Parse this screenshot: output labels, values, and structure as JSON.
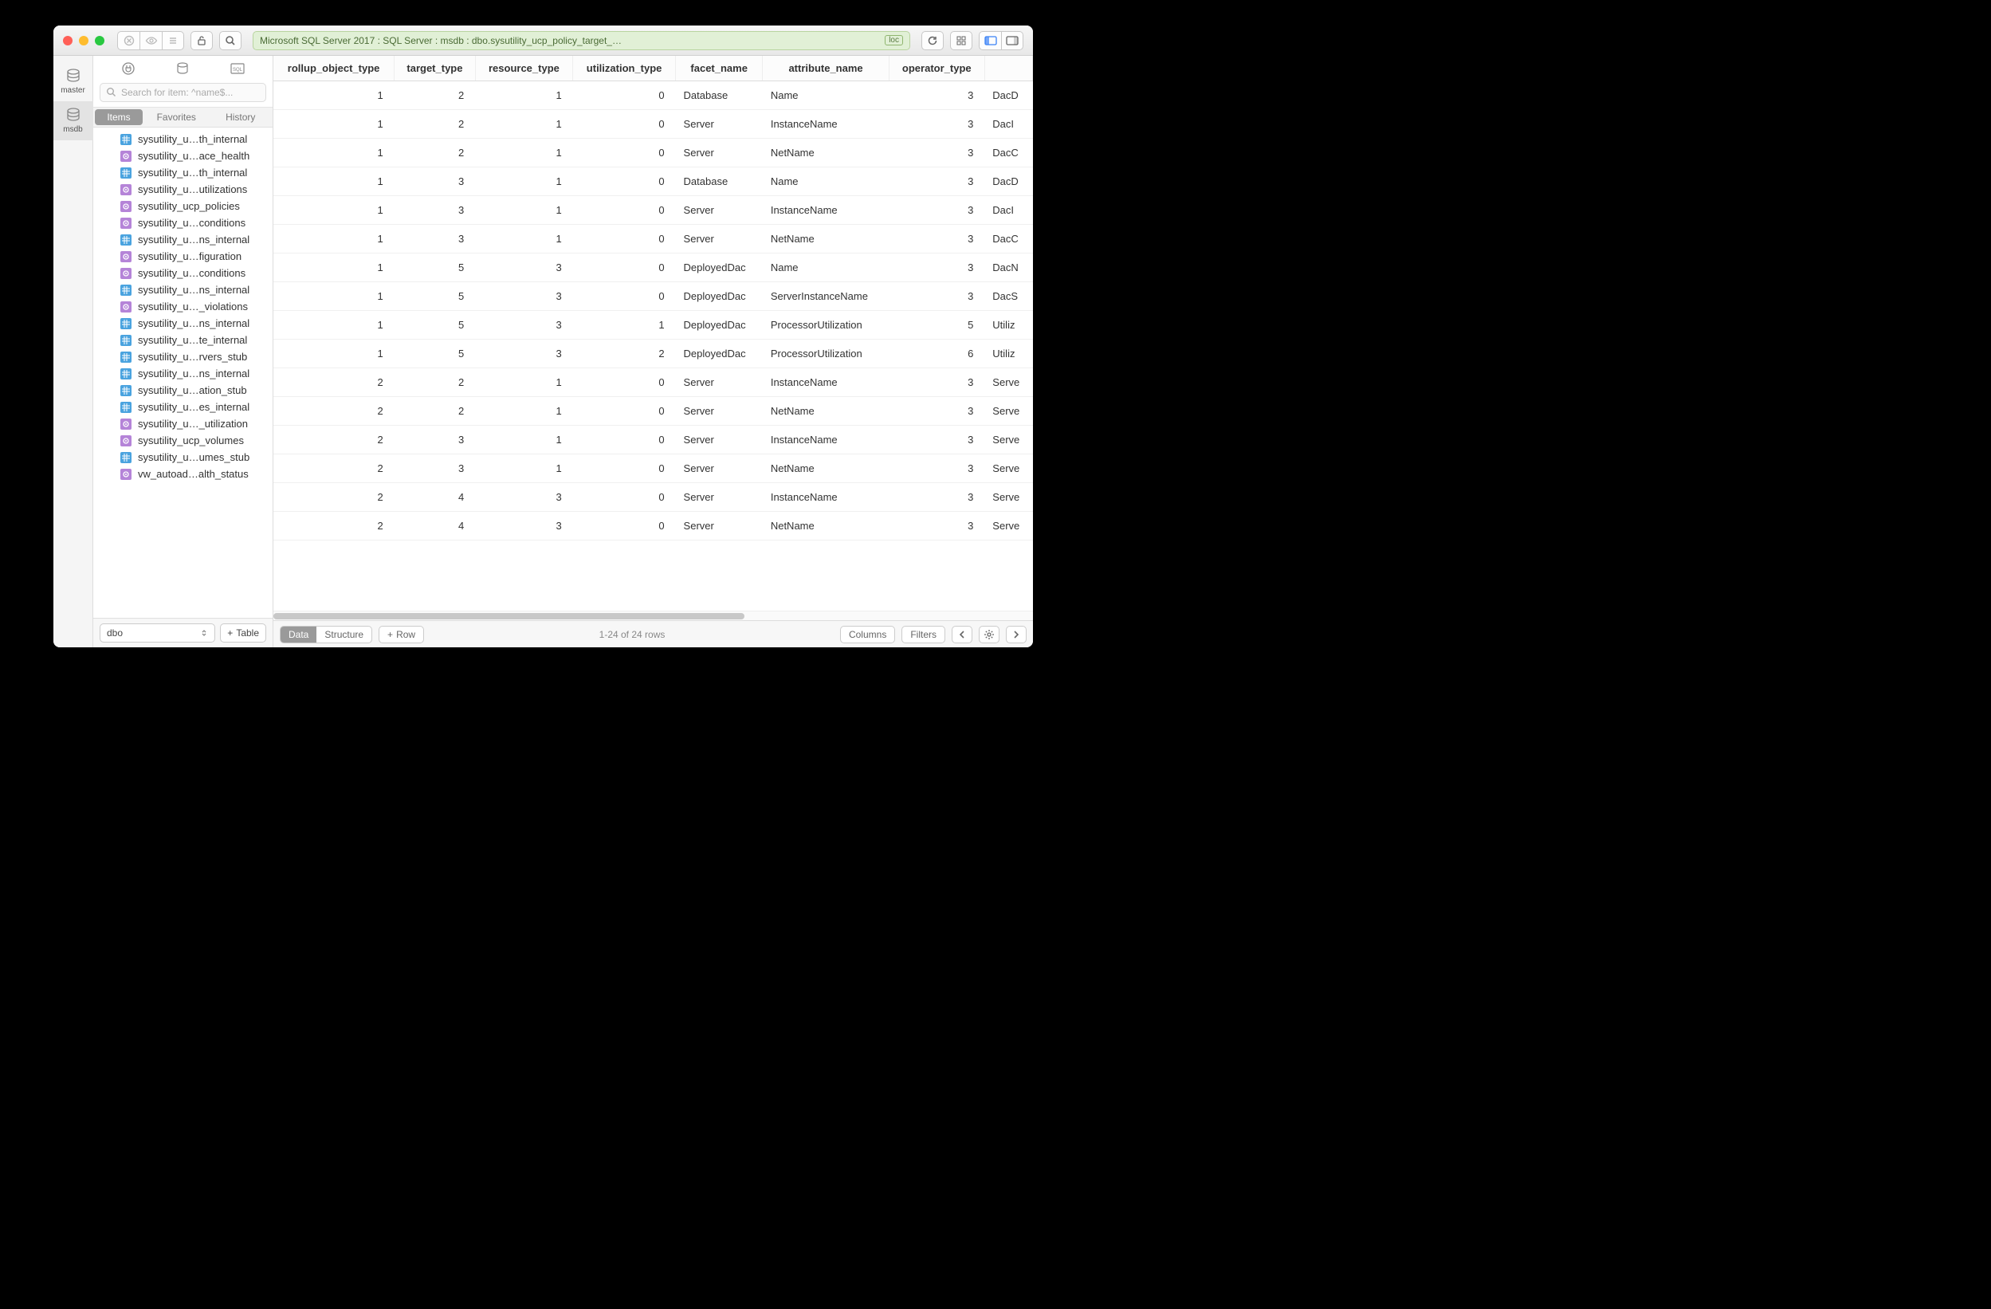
{
  "titlebar": {
    "breadcrumb": "Microsoft SQL Server 2017 : SQL Server : msdb : dbo.sysutility_ucp_policy_target_…",
    "loc_badge": "loc"
  },
  "dbbar": {
    "items": [
      {
        "name": "master",
        "selected": false
      },
      {
        "name": "msdb",
        "selected": true
      }
    ]
  },
  "sidebar": {
    "search_placeholder": "Search for item: ^name$...",
    "tabs": {
      "items": "Items",
      "favorites": "Favorites",
      "history": "History"
    },
    "tree": [
      {
        "type": "table",
        "label": "sysutility_u…th_internal"
      },
      {
        "type": "view",
        "label": "sysutility_u…ace_health"
      },
      {
        "type": "table",
        "label": "sysutility_u…th_internal"
      },
      {
        "type": "view",
        "label": "sysutility_u…utilizations"
      },
      {
        "type": "view",
        "label": "sysutility_ucp_policies"
      },
      {
        "type": "view",
        "label": "sysutility_u…conditions"
      },
      {
        "type": "table",
        "label": "sysutility_u…ns_internal"
      },
      {
        "type": "view",
        "label": "sysutility_u…figuration"
      },
      {
        "type": "view",
        "label": "sysutility_u…conditions"
      },
      {
        "type": "table",
        "label": "sysutility_u…ns_internal"
      },
      {
        "type": "view",
        "label": "sysutility_u…_violations"
      },
      {
        "type": "table",
        "label": "sysutility_u…ns_internal"
      },
      {
        "type": "table",
        "label": "sysutility_u…te_internal"
      },
      {
        "type": "table",
        "label": "sysutility_u…rvers_stub"
      },
      {
        "type": "table",
        "label": "sysutility_u…ns_internal"
      },
      {
        "type": "table",
        "label": "sysutility_u…ation_stub"
      },
      {
        "type": "table",
        "label": "sysutility_u…es_internal"
      },
      {
        "type": "view",
        "label": "sysutility_u…_utilization"
      },
      {
        "type": "view",
        "label": "sysutility_ucp_volumes"
      },
      {
        "type": "table",
        "label": "sysutility_u…umes_stub"
      },
      {
        "type": "view",
        "label": "vw_autoad…alth_status"
      }
    ],
    "schema": "dbo",
    "add_table": "Table"
  },
  "grid": {
    "columns": [
      "rollup_object_type",
      "target_type",
      "resource_type",
      "utilization_type",
      "facet_name",
      "attribute_name",
      "operator_type",
      ""
    ],
    "rows": [
      {
        "rollup_object_type": 1,
        "target_type": 2,
        "resource_type": 1,
        "utilization_type": 0,
        "facet_name": "Database",
        "attribute_name": "Name",
        "operator_type": 3,
        "tail": "DacD"
      },
      {
        "rollup_object_type": 1,
        "target_type": 2,
        "resource_type": 1,
        "utilization_type": 0,
        "facet_name": "Server",
        "attribute_name": "InstanceName",
        "operator_type": 3,
        "tail": "DacI"
      },
      {
        "rollup_object_type": 1,
        "target_type": 2,
        "resource_type": 1,
        "utilization_type": 0,
        "facet_name": "Server",
        "attribute_name": "NetName",
        "operator_type": 3,
        "tail": "DacC"
      },
      {
        "rollup_object_type": 1,
        "target_type": 3,
        "resource_type": 1,
        "utilization_type": 0,
        "facet_name": "Database",
        "attribute_name": "Name",
        "operator_type": 3,
        "tail": "DacD"
      },
      {
        "rollup_object_type": 1,
        "target_type": 3,
        "resource_type": 1,
        "utilization_type": 0,
        "facet_name": "Server",
        "attribute_name": "InstanceName",
        "operator_type": 3,
        "tail": "DacI"
      },
      {
        "rollup_object_type": 1,
        "target_type": 3,
        "resource_type": 1,
        "utilization_type": 0,
        "facet_name": "Server",
        "attribute_name": "NetName",
        "operator_type": 3,
        "tail": "DacC"
      },
      {
        "rollup_object_type": 1,
        "target_type": 5,
        "resource_type": 3,
        "utilization_type": 0,
        "facet_name": "DeployedDac",
        "attribute_name": "Name",
        "operator_type": 3,
        "tail": "DacN"
      },
      {
        "rollup_object_type": 1,
        "target_type": 5,
        "resource_type": 3,
        "utilization_type": 0,
        "facet_name": "DeployedDac",
        "attribute_name": "ServerInstanceName",
        "operator_type": 3,
        "tail": "DacS"
      },
      {
        "rollup_object_type": 1,
        "target_type": 5,
        "resource_type": 3,
        "utilization_type": 1,
        "facet_name": "DeployedDac",
        "attribute_name": "ProcessorUtilization",
        "operator_type": 5,
        "tail": "Utiliz"
      },
      {
        "rollup_object_type": 1,
        "target_type": 5,
        "resource_type": 3,
        "utilization_type": 2,
        "facet_name": "DeployedDac",
        "attribute_name": "ProcessorUtilization",
        "operator_type": 6,
        "tail": "Utiliz"
      },
      {
        "rollup_object_type": 2,
        "target_type": 2,
        "resource_type": 1,
        "utilization_type": 0,
        "facet_name": "Server",
        "attribute_name": "InstanceName",
        "operator_type": 3,
        "tail": "Serve"
      },
      {
        "rollup_object_type": 2,
        "target_type": 2,
        "resource_type": 1,
        "utilization_type": 0,
        "facet_name": "Server",
        "attribute_name": "NetName",
        "operator_type": 3,
        "tail": "Serve"
      },
      {
        "rollup_object_type": 2,
        "target_type": 3,
        "resource_type": 1,
        "utilization_type": 0,
        "facet_name": "Server",
        "attribute_name": "InstanceName",
        "operator_type": 3,
        "tail": "Serve"
      },
      {
        "rollup_object_type": 2,
        "target_type": 3,
        "resource_type": 1,
        "utilization_type": 0,
        "facet_name": "Server",
        "attribute_name": "NetName",
        "operator_type": 3,
        "tail": "Serve"
      },
      {
        "rollup_object_type": 2,
        "target_type": 4,
        "resource_type": 3,
        "utilization_type": 0,
        "facet_name": "Server",
        "attribute_name": "InstanceName",
        "operator_type": 3,
        "tail": "Serve"
      },
      {
        "rollup_object_type": 2,
        "target_type": 4,
        "resource_type": 3,
        "utilization_type": 0,
        "facet_name": "Server",
        "attribute_name": "NetName",
        "operator_type": 3,
        "tail": "Serve"
      }
    ]
  },
  "footer": {
    "data": "Data",
    "structure": "Structure",
    "row": "Row",
    "status": "1-24 of 24 rows",
    "columns": "Columns",
    "filters": "Filters"
  }
}
